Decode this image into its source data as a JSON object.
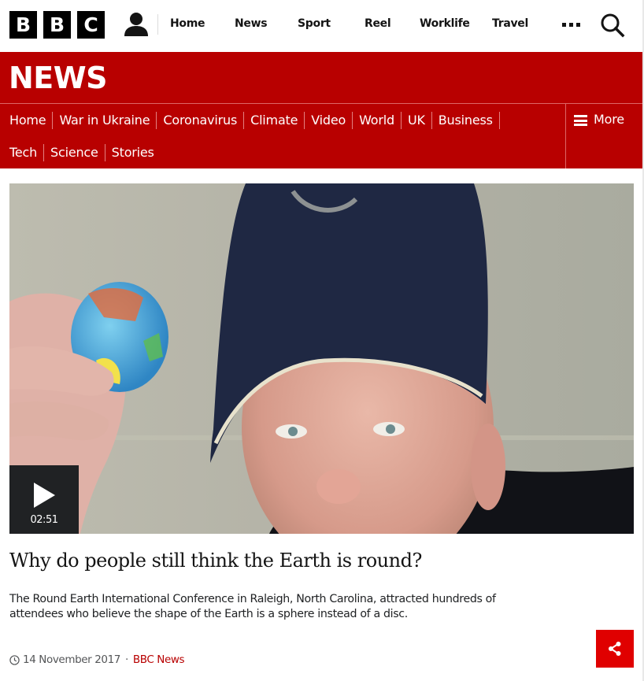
{
  "global_nav": {
    "logo": [
      "B",
      "B",
      "C"
    ],
    "account_icon": "user-icon",
    "items": [
      {
        "label": "Home"
      },
      {
        "label": "News"
      },
      {
        "label": "Sport"
      },
      {
        "label": "Reel"
      },
      {
        "label": "Worklife"
      },
      {
        "label": "Travel"
      }
    ],
    "more_icon": "more-dots-icon",
    "search_icon": "search-icon"
  },
  "news_header": {
    "title": "NEWS",
    "brand_color": "#b80000",
    "sections_row1": [
      {
        "label": "Home"
      },
      {
        "label": "War in Ukraine"
      },
      {
        "label": "Coronavirus"
      },
      {
        "label": "Climate"
      },
      {
        "label": "Video"
      },
      {
        "label": "World"
      },
      {
        "label": "UK"
      },
      {
        "label": "Business"
      }
    ],
    "sections_row2": [
      {
        "label": "Tech"
      },
      {
        "label": "Science"
      },
      {
        "label": "Stories"
      }
    ],
    "more_label": "More",
    "more_icon": "hamburger-icon"
  },
  "media": {
    "description": "Man in navy baseball cap holding a small globe",
    "play_icon": "play-icon",
    "duration": "02:51"
  },
  "article": {
    "headline": "Why do people still think the Earth is round?",
    "summary": "The Round Earth International Conference in Raleigh, North Carolina, attracted hundreds of attendees who believe the shape of the Earth is a sphere instead of a disc.",
    "date": "14 November 2017",
    "separator": "·",
    "source": "BBC News",
    "share_icon": "share-icon",
    "share_color": "#e00000"
  }
}
